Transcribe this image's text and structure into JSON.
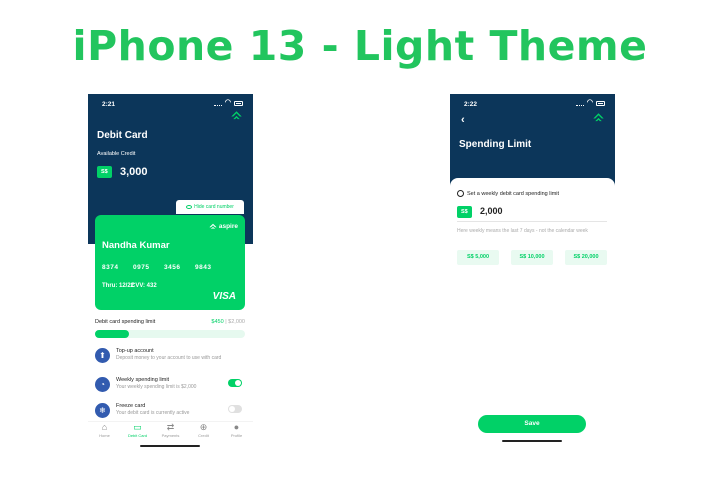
{
  "page": {
    "title": "iPhone 13 - Light Theme"
  },
  "colors": {
    "title": "#22c55e",
    "navy": "#0c365a",
    "accent": "#01d167",
    "icon_blue": "#325baf"
  },
  "screen1": {
    "status_time": "2:21",
    "title": "Debit Card",
    "available_label": "Available Credit",
    "currency": "S$",
    "balance": "3,000",
    "hide_card_label": "Hide card number",
    "card": {
      "brand": "aspire",
      "name": "Nandha Kumar",
      "number_groups": [
        "8374",
        "0975",
        "3456",
        "9843"
      ],
      "thru": "Thru: 12/22",
      "cvv": "CVV: 432",
      "network": "VISA"
    },
    "spending": {
      "label": "Debit card spending limit",
      "used": "$450",
      "separator": " | ",
      "total": "$2,000",
      "progress_fraction": 0.225
    },
    "options": [
      {
        "icon": "top-up-icon",
        "title": "Top-up account",
        "desc": "Deposit money to your account to use with card"
      },
      {
        "icon": "speedometer-icon",
        "title": "Weekly spending limit",
        "desc": "Your weekly spending limit is $2,000",
        "toggle": "on"
      },
      {
        "icon": "freeze-icon",
        "title": "Freeze card",
        "desc": "Your debit card is currently active",
        "toggle": "off"
      }
    ],
    "tabs": [
      {
        "icon": "home-icon",
        "label": "Home"
      },
      {
        "icon": "card-icon",
        "label": "Debit Card",
        "active": true
      },
      {
        "icon": "payments-icon",
        "label": "Payments"
      },
      {
        "icon": "credit-icon",
        "label": "Credit"
      },
      {
        "icon": "profile-icon",
        "label": "Profile"
      }
    ]
  },
  "screen2": {
    "status_time": "2:22",
    "title": "Spending Limit",
    "subtitle": "Set a weekly debit card spending limit",
    "currency": "S$",
    "amount": "2,000",
    "note": "Here weekly means the last 7 days - not the calendar week",
    "presets": [
      "S$ 5,000",
      "S$ 10,000",
      "S$ 20,000"
    ],
    "save_label": "Save"
  }
}
